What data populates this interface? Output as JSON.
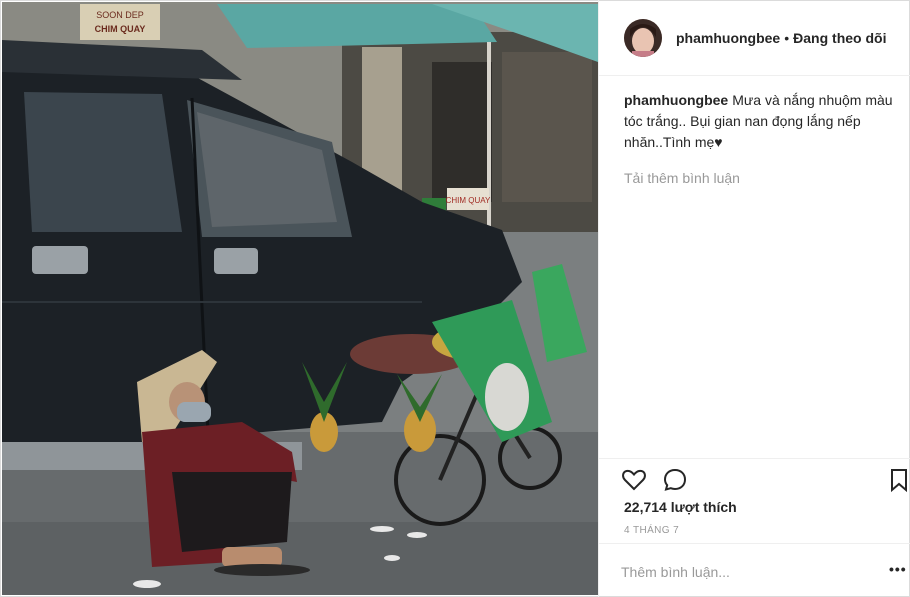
{
  "post": {
    "username": "phamhuongbee",
    "separator": "•",
    "follow_status": "Đang theo dõi",
    "caption_text": "Mưa và nắng nhuộm màu tóc trắng.. Bụi gian nan đọng lắng nếp nhăn..Tình mẹ♥",
    "load_more": "Tải thêm bình luận",
    "likes": "22,714 lượt thích",
    "date": "4 THÁNG 7",
    "comment_placeholder": "Thêm bình luận...",
    "more_symbol": "•••"
  },
  "photo": {
    "signs": {
      "top_left": "SOON DEP",
      "top_left_2": "CHIM QUAY",
      "shop": "CHIM QUAY"
    }
  },
  "icons": {
    "like": "heart-icon",
    "comment": "comment-icon",
    "save": "bookmark-icon",
    "more": "more-options-icon"
  },
  "colors": {
    "text": "#262626",
    "muted": "#999999",
    "border": "#efefef",
    "truck": "#1c2126",
    "awning": "#5aa7a3",
    "bag_green": "#2f9a58"
  }
}
